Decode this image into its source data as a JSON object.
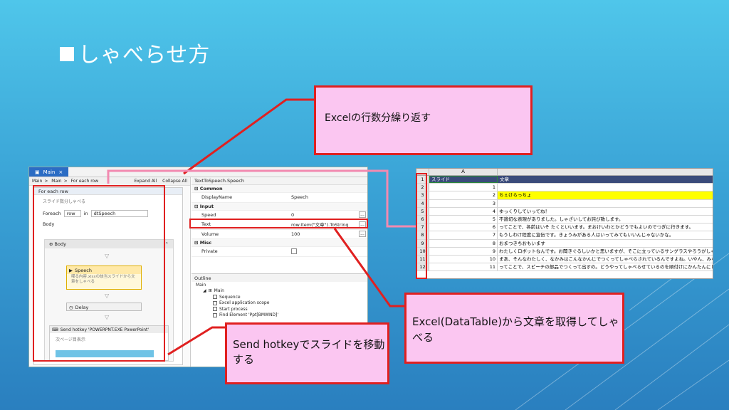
{
  "slide": {
    "title": "しゃべらせ方"
  },
  "studio": {
    "tab_label": "Main",
    "tab_close": "×",
    "breadcrumbs": [
      "Main",
      "Main",
      "For each row"
    ],
    "crumb_sep": ">",
    "expand_all": "Expand All",
    "collapse_all": "Collapse All",
    "foreach": {
      "title": "For each row",
      "note": "スライド数分しゃべる",
      "foreach_label": "Foreach",
      "foreach_var": "row",
      "in_label": "in",
      "collection": "dtSpeech",
      "body_label": "Body"
    },
    "sequence_label": "Body",
    "speech": {
      "title": "Speech",
      "sub": "喋る内容.xlsxの該当スライドから文章をしゃべる"
    },
    "delay": {
      "title": "Delay"
    },
    "hotkey": {
      "title": "Send hotkey 'POWERPNT.EXE PowerPoint'",
      "sub": "次ページ目表示"
    }
  },
  "properties": {
    "title": "TextToSpeech.Speech",
    "common_label": "Common",
    "input_label": "Input",
    "misc_label": "Misc",
    "rows": {
      "display_name": {
        "key": "DisplayName",
        "value": "Speech"
      },
      "speed": {
        "key": "Speed",
        "value": "0"
      },
      "text": {
        "key": "Text",
        "value": "row.Item(\"文章\").ToString"
      },
      "volume": {
        "key": "Volume",
        "value": "100"
      },
      "private": {
        "key": "Private"
      }
    },
    "dots": "..."
  },
  "outline": {
    "title": "Outline",
    "items": [
      "Main",
      "Main",
      "Sequence",
      "Excel application scope",
      "Start process",
      "Find Element 'Ppt[BMWND]'"
    ]
  },
  "excel": {
    "col_a": "A",
    "header": {
      "row": "1",
      "a": "スライド",
      "b": "文章"
    },
    "rows": [
      {
        "n": "2",
        "a": "1",
        "b": ""
      },
      {
        "n": "3",
        "a": "2",
        "b": "ちぇけらっちょ"
      },
      {
        "n": "4",
        "a": "3",
        "b": ""
      },
      {
        "n": "5",
        "a": "4",
        "b": "ゆっくりしていってね！"
      },
      {
        "n": "6",
        "a": "5",
        "b": "不適切な表現がありました。しゃざいしてお詫び致します。"
      },
      {
        "n": "7",
        "a": "6",
        "b": "ってことで、各前はいそ たくといいます。まおけいわとかどうでもよいのでつぎに行きます。"
      },
      {
        "n": "8",
        "a": "7",
        "b": "もうしわけ程度に宣伝です。きょうみがある人はいってみてもいいんじゃないかな。"
      },
      {
        "n": "9",
        "a": "8",
        "b": "おまつきちおもいます"
      },
      {
        "n": "10",
        "a": "9",
        "b": "わたしくロボットなんです。お聞きぐるしいかと思いますが、そこに立っているサングラスやろうがしゃべり"
      },
      {
        "n": "11",
        "a": "10",
        "b": "まあ、そんなわたしく、なかみはこんなかんじでつくってしゃべらされているんですよね。いやん、みないでください"
      },
      {
        "n": "12",
        "a": "11",
        "b": "ってことで、スピーチの部品でつくって出すの。どうやってしゃべらせているのを順付けにかんたんにしゃべ"
      }
    ]
  },
  "callouts": {
    "excel_rows": "Excelの行数分繰り返す",
    "datatable": "Excel(DataTable)から文章を取得してしゃべる",
    "hotkey": "Send hotkeyでスライドを移動する"
  },
  "colors": {
    "frame_red": "#e02020",
    "callout_pink": "#fbc6f1",
    "selected_tab": "#2b6cc4"
  }
}
